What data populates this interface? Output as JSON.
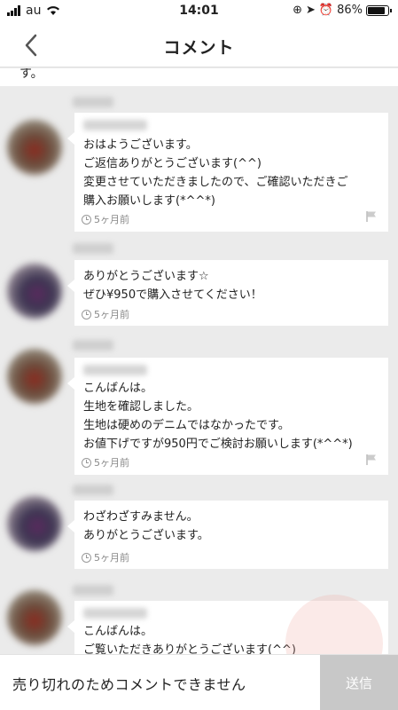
{
  "status_bar": {
    "carrier": "au",
    "time": "14:01",
    "battery": "86%",
    "battery_level": 0.86
  },
  "nav": {
    "title": "コメント",
    "back_icon": "chevron-left-icon"
  },
  "top_partial_text": "す。",
  "comments": [
    {
      "message": "おはようございます。\nご返信ありがとうございます(^^)\n変更させていただきましたので、ご確認いただきご\n購入お願いします(*^^*)",
      "time": "5ヶ月前",
      "flag": true
    },
    {
      "message": "ありがとうございます☆\nぜひ¥950で購入させてください！",
      "time": "5ヶ月前",
      "flag": false
    },
    {
      "message": "こんばんは。\n生地を確認しました。\n生地は硬めのデニムではなかったです。\nお値下げですが950円でご検討お願いします(*^^*)",
      "time": "5ヶ月前",
      "flag": true
    },
    {
      "message": "わざわざすみません。\nありがとうございます。",
      "time": "5ヶ月前",
      "flag": false
    },
    {
      "message": "こんばんは。\nご覧いただきありがとうございます(^^)",
      "time": "",
      "flag": false
    }
  ],
  "footer": {
    "disabled_message": "売り切れのためコメントできません",
    "send_label": "送信"
  }
}
